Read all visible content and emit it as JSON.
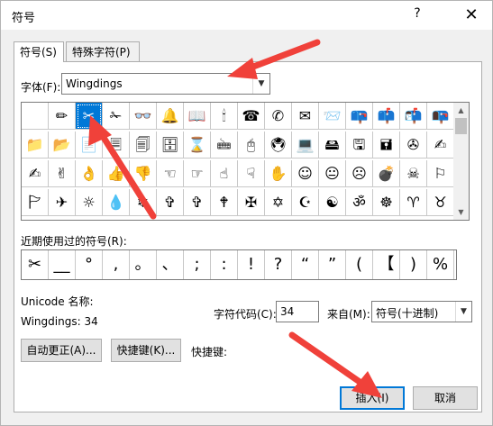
{
  "window": {
    "title": "符号",
    "help": "?",
    "close": "✕"
  },
  "tabs": [
    {
      "label": "符号(S)"
    },
    {
      "label": "特殊字符(P)"
    }
  ],
  "font": {
    "label": "字体(F):",
    "value": "Wingdings"
  },
  "symbols": [
    " ",
    "✏",
    "✂",
    "✁",
    "👓",
    "🔔",
    "📖",
    "🕯",
    "☎",
    "✆",
    "✉",
    "📨",
    "📪",
    "📫",
    "📬",
    "📭",
    "📁",
    "📂",
    "📄",
    "🗏",
    "🗐",
    "🗄",
    "⌛",
    "🖮",
    "🖰",
    "🖲",
    "💻",
    "🖴",
    "🖫",
    "🖬",
    "✇",
    "✍",
    "✍",
    "✌",
    "👌",
    "👍",
    "👎",
    "☜",
    "☞",
    "☝",
    "☟",
    "✋",
    "☺",
    "😐",
    "☹",
    "💣",
    "☠",
    "⚐",
    "🏱",
    "✈",
    "☼",
    "💧",
    "❄",
    "✞",
    "✞",
    "🕈",
    "✠",
    "✡",
    "☪",
    "☯",
    "ॐ",
    "☸",
    "♈",
    "♉"
  ],
  "recent": {
    "label": "近期使用过的符号(R):",
    "items": [
      "✂",
      "__",
      "°",
      ",",
      "。",
      "、",
      ";",
      ":",
      "!",
      "?",
      "“",
      "”",
      "(",
      "【",
      ")",
      "%"
    ]
  },
  "unicode_name": {
    "label": "Unicode 名称:"
  },
  "font_code": "Wingdings: 34",
  "char_code": {
    "label": "字符代码(C):",
    "value": "34"
  },
  "from": {
    "label": "来自(M):",
    "value": "符号(十进制)"
  },
  "buttons": {
    "autocorrect": "自动更正(A)...",
    "shortcut": "快捷键(K)...",
    "insert": "插入(I)",
    "cancel": "取消"
  },
  "shortcut_label": "快捷键:",
  "colors": {
    "selected": "#0078d7",
    "annotation": "#f0413a"
  }
}
